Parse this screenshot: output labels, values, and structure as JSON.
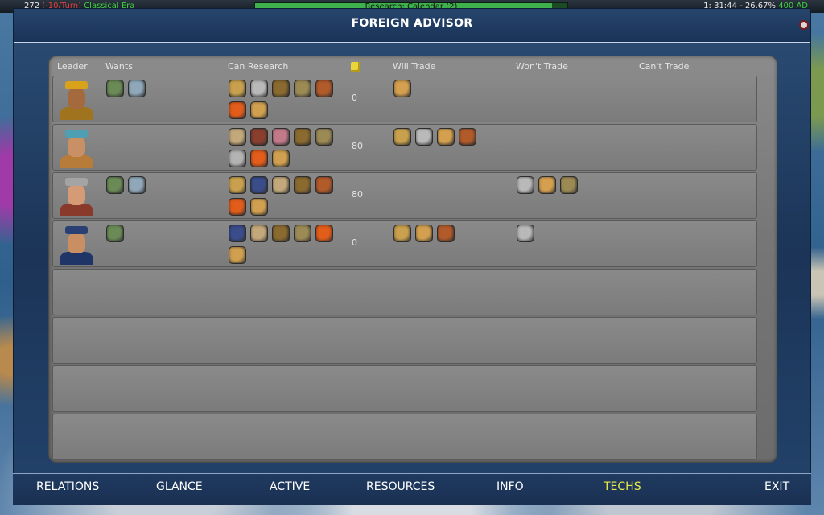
{
  "top_bar": {
    "left_text": "272",
    "left_negative": "(-10/Turn)",
    "era": "Classical Era",
    "research_text": "Research: Calendar (2)",
    "research_fraction": 0.95,
    "right_text": "1: 31:44 - 26.67%",
    "right_date": "400 AD"
  },
  "window": {
    "title": "FOREIGN ADVISOR"
  },
  "columns": {
    "leader": "Leader",
    "wants": "Wants",
    "can_research": "Can Research",
    "will_trade": "Will Trade",
    "wont_trade": "Won't Trade",
    "cant_trade": "Can't Trade",
    "gold_icon": "gold-icon"
  },
  "rows": [
    {
      "leader": "Persian leader",
      "portrait_colors": {
        "hat": "#d8a21a",
        "face": "#a46a3e",
        "body": "#a0731f"
      },
      "gold": "0",
      "wants": [
        "#6a8b56",
        "#8fa7b8"
      ],
      "can_research": [
        "#c9a14e",
        "#b9b9b9",
        "#8a6a2e",
        "#9c8a55",
        "#b15a2a",
        "#e25c1a",
        "#d0a050"
      ],
      "will_trade": [
        "#d4a050"
      ],
      "wont_trade": []
    },
    {
      "leader": "Aztec leader",
      "portrait_colors": {
        "hat": "#4f9fb4",
        "face": "#c99066",
        "body": "#b77b3a"
      },
      "gold": "80",
      "wants": [],
      "can_research": [
        "#c2a87a",
        "#8a3f2e",
        "#c27a8a",
        "#8a6a2e",
        "#9c8a55",
        "#b3b3b3",
        "#e25c1a",
        "#d0a050"
      ],
      "will_trade": [
        "#c9a14e",
        "#b9b9b9",
        "#d4a050",
        "#b15a2a"
      ],
      "wont_trade": []
    },
    {
      "leader": "Egyptian leader",
      "portrait_colors": {
        "hat": "#a4a4a4",
        "face": "#d49b76",
        "body": "#8a3a2a"
      },
      "gold": "80",
      "wants": [
        "#6a8b56",
        "#8fa7b8"
      ],
      "can_research": [
        "#c9a14e",
        "#3a4c8a",
        "#c2a87a",
        "#8a6a2e",
        "#b15a2a",
        "#e25c1a",
        "#d0a050"
      ],
      "will_trade": [],
      "wont_trade": [
        "#b9b9b9",
        "#d4a050",
        "#9c8a55"
      ]
    },
    {
      "leader": "Chinese leader",
      "portrait_colors": {
        "hat": "#2a3f74",
        "face": "#c98f63",
        "body": "#1f3568"
      },
      "gold": "0",
      "wants": [
        "#6a8b56"
      ],
      "can_research": [
        "#3a4c8a",
        "#c2a87a",
        "#8a6a2e",
        "#9c8a55",
        "#e25c1a",
        "#d0a050"
      ],
      "will_trade": [
        "#c9a14e",
        "#d4a050",
        "#b15a2a"
      ],
      "wont_trade": [
        "#b9b9b9"
      ]
    }
  ],
  "tabs": [
    {
      "label": "RELATIONS",
      "active": false
    },
    {
      "label": "GLANCE",
      "active": false
    },
    {
      "label": "ACTIVE",
      "active": false
    },
    {
      "label": "RESOURCES",
      "active": false
    },
    {
      "label": "INFO",
      "active": false
    },
    {
      "label": "TECHS",
      "active": true
    },
    {
      "label": "EXIT",
      "active": false
    }
  ],
  "colors": {
    "active_tab": "#e8e84a",
    "title": "#ffffff",
    "panel": "#7b7b7b"
  }
}
